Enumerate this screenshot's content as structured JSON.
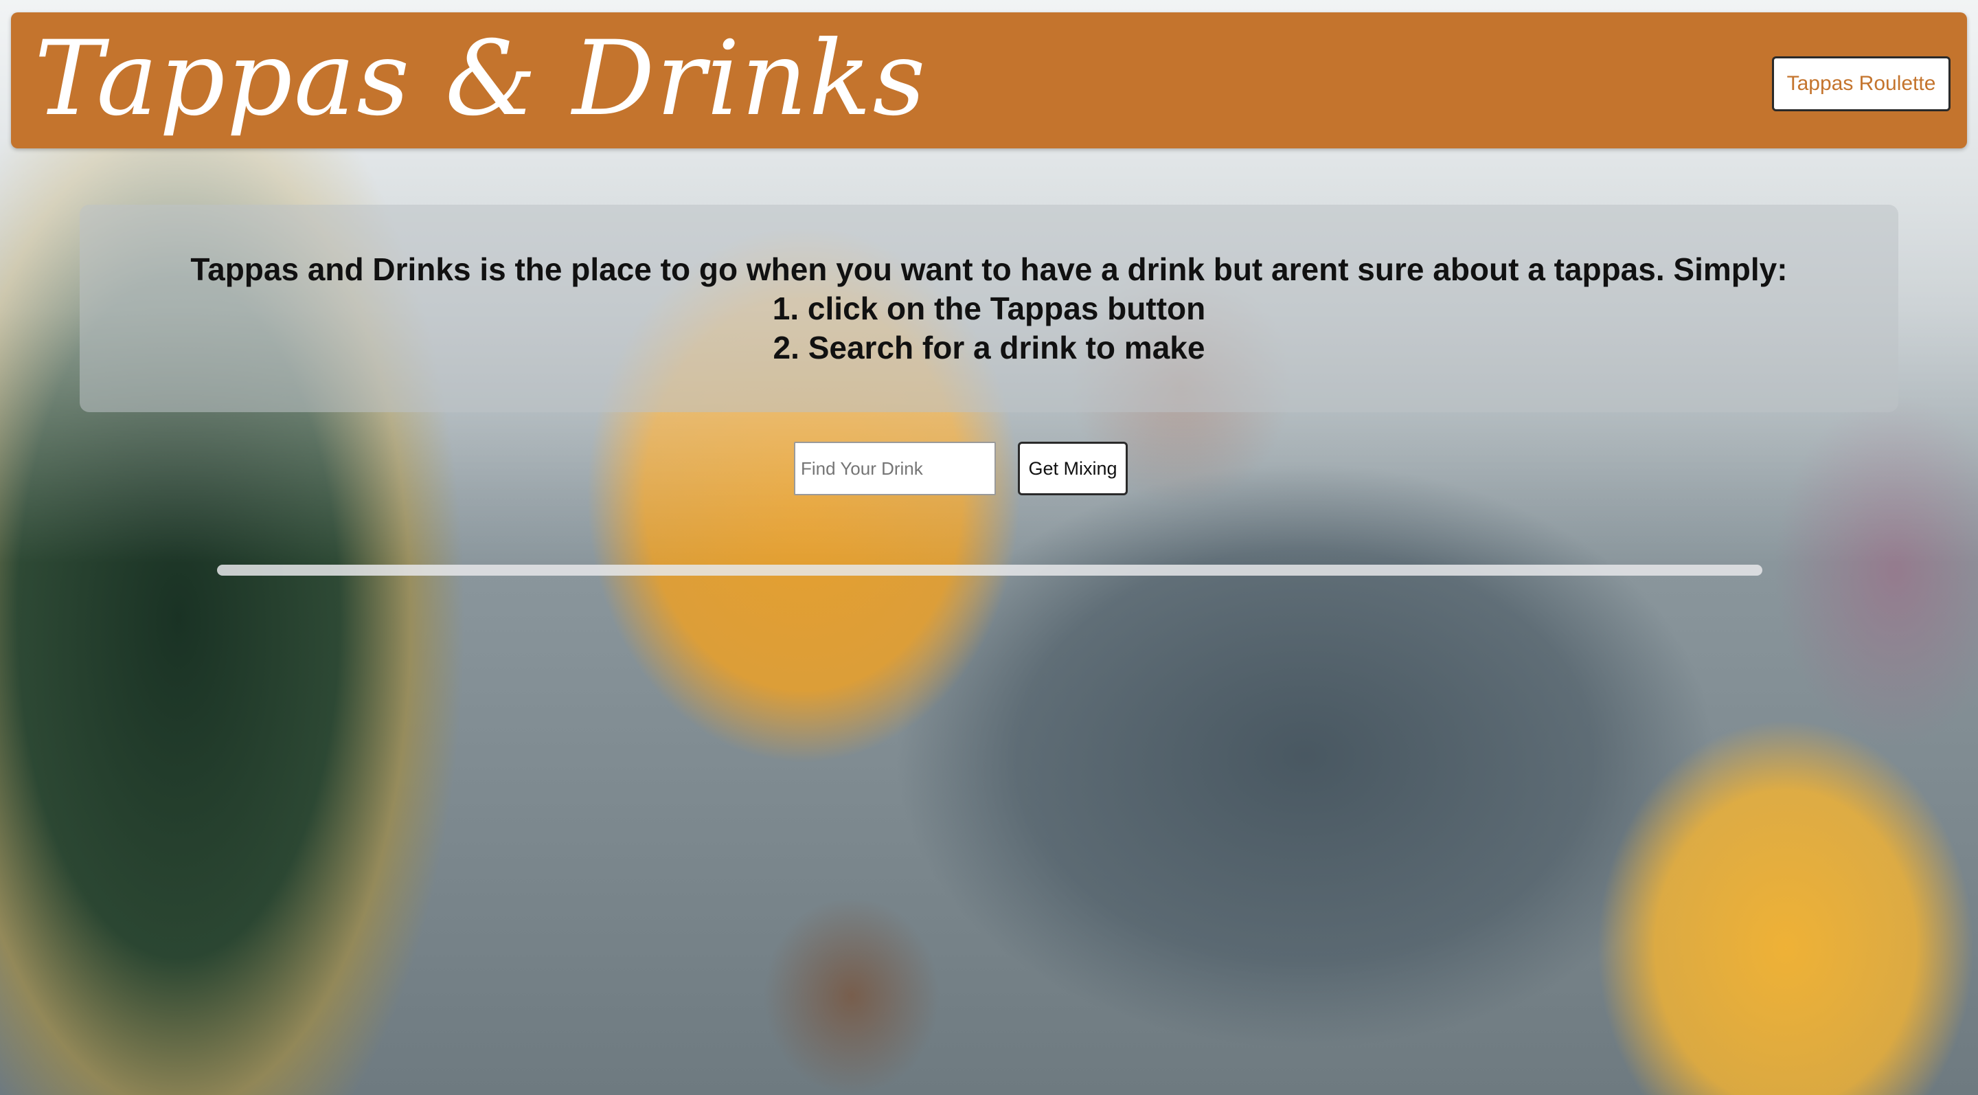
{
  "header": {
    "logo_text": "Tappas & Drinks",
    "roulette_label": "Tappas Roulette"
  },
  "intro": {
    "line1": "Tappas and Drinks is the place to go when you want to have a drink but arent sure about a tappas. Simply:",
    "line2": "1. click on the Tappas button",
    "line3": "2. Search for a drink to make"
  },
  "search": {
    "placeholder": "Find Your Drink",
    "value": "",
    "button_label": "Get Mixing"
  },
  "colors": {
    "header_bg": "#c4742d",
    "accent_text": "#c4742d"
  }
}
